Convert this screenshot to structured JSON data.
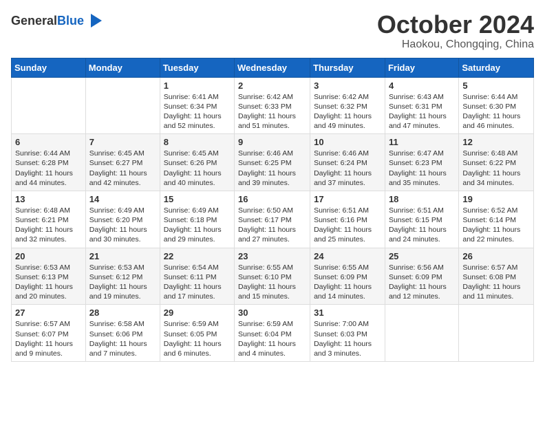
{
  "logo": {
    "general": "General",
    "blue": "Blue"
  },
  "header": {
    "month": "October 2024",
    "location": "Haokou, Chongqing, China"
  },
  "weekdays": [
    "Sunday",
    "Monday",
    "Tuesday",
    "Wednesday",
    "Thursday",
    "Friday",
    "Saturday"
  ],
  "weeks": [
    [
      {
        "day": "",
        "info": ""
      },
      {
        "day": "",
        "info": ""
      },
      {
        "day": "1",
        "info": "Sunrise: 6:41 AM\nSunset: 6:34 PM\nDaylight: 11 hours and 52 minutes."
      },
      {
        "day": "2",
        "info": "Sunrise: 6:42 AM\nSunset: 6:33 PM\nDaylight: 11 hours and 51 minutes."
      },
      {
        "day": "3",
        "info": "Sunrise: 6:42 AM\nSunset: 6:32 PM\nDaylight: 11 hours and 49 minutes."
      },
      {
        "day": "4",
        "info": "Sunrise: 6:43 AM\nSunset: 6:31 PM\nDaylight: 11 hours and 47 minutes."
      },
      {
        "day": "5",
        "info": "Sunrise: 6:44 AM\nSunset: 6:30 PM\nDaylight: 11 hours and 46 minutes."
      }
    ],
    [
      {
        "day": "6",
        "info": "Sunrise: 6:44 AM\nSunset: 6:28 PM\nDaylight: 11 hours and 44 minutes."
      },
      {
        "day": "7",
        "info": "Sunrise: 6:45 AM\nSunset: 6:27 PM\nDaylight: 11 hours and 42 minutes."
      },
      {
        "day": "8",
        "info": "Sunrise: 6:45 AM\nSunset: 6:26 PM\nDaylight: 11 hours and 40 minutes."
      },
      {
        "day": "9",
        "info": "Sunrise: 6:46 AM\nSunset: 6:25 PM\nDaylight: 11 hours and 39 minutes."
      },
      {
        "day": "10",
        "info": "Sunrise: 6:46 AM\nSunset: 6:24 PM\nDaylight: 11 hours and 37 minutes."
      },
      {
        "day": "11",
        "info": "Sunrise: 6:47 AM\nSunset: 6:23 PM\nDaylight: 11 hours and 35 minutes."
      },
      {
        "day": "12",
        "info": "Sunrise: 6:48 AM\nSunset: 6:22 PM\nDaylight: 11 hours and 34 minutes."
      }
    ],
    [
      {
        "day": "13",
        "info": "Sunrise: 6:48 AM\nSunset: 6:21 PM\nDaylight: 11 hours and 32 minutes."
      },
      {
        "day": "14",
        "info": "Sunrise: 6:49 AM\nSunset: 6:20 PM\nDaylight: 11 hours and 30 minutes."
      },
      {
        "day": "15",
        "info": "Sunrise: 6:49 AM\nSunset: 6:18 PM\nDaylight: 11 hours and 29 minutes."
      },
      {
        "day": "16",
        "info": "Sunrise: 6:50 AM\nSunset: 6:17 PM\nDaylight: 11 hours and 27 minutes."
      },
      {
        "day": "17",
        "info": "Sunrise: 6:51 AM\nSunset: 6:16 PM\nDaylight: 11 hours and 25 minutes."
      },
      {
        "day": "18",
        "info": "Sunrise: 6:51 AM\nSunset: 6:15 PM\nDaylight: 11 hours and 24 minutes."
      },
      {
        "day": "19",
        "info": "Sunrise: 6:52 AM\nSunset: 6:14 PM\nDaylight: 11 hours and 22 minutes."
      }
    ],
    [
      {
        "day": "20",
        "info": "Sunrise: 6:53 AM\nSunset: 6:13 PM\nDaylight: 11 hours and 20 minutes."
      },
      {
        "day": "21",
        "info": "Sunrise: 6:53 AM\nSunset: 6:12 PM\nDaylight: 11 hours and 19 minutes."
      },
      {
        "day": "22",
        "info": "Sunrise: 6:54 AM\nSunset: 6:11 PM\nDaylight: 11 hours and 17 minutes."
      },
      {
        "day": "23",
        "info": "Sunrise: 6:55 AM\nSunset: 6:10 PM\nDaylight: 11 hours and 15 minutes."
      },
      {
        "day": "24",
        "info": "Sunrise: 6:55 AM\nSunset: 6:09 PM\nDaylight: 11 hours and 14 minutes."
      },
      {
        "day": "25",
        "info": "Sunrise: 6:56 AM\nSunset: 6:09 PM\nDaylight: 11 hours and 12 minutes."
      },
      {
        "day": "26",
        "info": "Sunrise: 6:57 AM\nSunset: 6:08 PM\nDaylight: 11 hours and 11 minutes."
      }
    ],
    [
      {
        "day": "27",
        "info": "Sunrise: 6:57 AM\nSunset: 6:07 PM\nDaylight: 11 hours and 9 minutes."
      },
      {
        "day": "28",
        "info": "Sunrise: 6:58 AM\nSunset: 6:06 PM\nDaylight: 11 hours and 7 minutes."
      },
      {
        "day": "29",
        "info": "Sunrise: 6:59 AM\nSunset: 6:05 PM\nDaylight: 11 hours and 6 minutes."
      },
      {
        "day": "30",
        "info": "Sunrise: 6:59 AM\nSunset: 6:04 PM\nDaylight: 11 hours and 4 minutes."
      },
      {
        "day": "31",
        "info": "Sunrise: 7:00 AM\nSunset: 6:03 PM\nDaylight: 11 hours and 3 minutes."
      },
      {
        "day": "",
        "info": ""
      },
      {
        "day": "",
        "info": ""
      }
    ]
  ]
}
